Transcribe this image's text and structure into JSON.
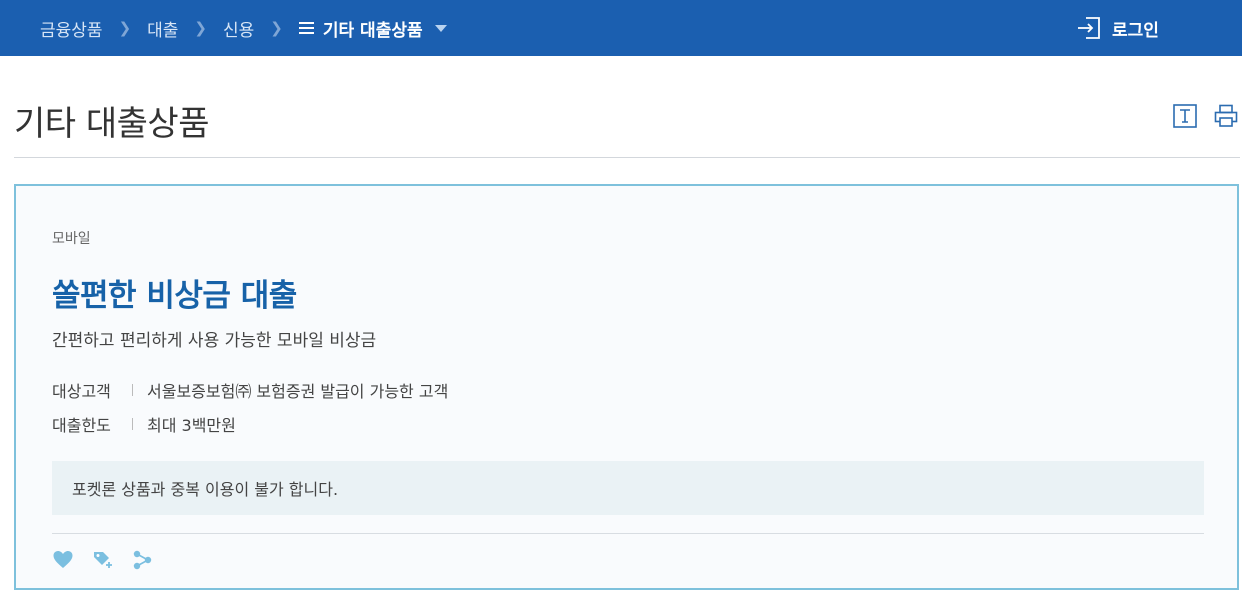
{
  "breadcrumb": {
    "items": [
      "금융상품",
      "대출",
      "신용"
    ],
    "current": "기타 대출상품"
  },
  "header": {
    "login_label": "로그인"
  },
  "page": {
    "title": "기타 대출상품",
    "icons": [
      "font-size-icon",
      "print-icon"
    ]
  },
  "product": {
    "category": "모바일",
    "name": "쏠편한 비상금 대출",
    "description": "간편하고 편리하게 사용 가능한 모바일 비상금",
    "info": [
      {
        "label": "대상고객",
        "value": "서울보증보험㈜ 보험증권 발급이 가능한 고객"
      },
      {
        "label": "대출한도",
        "value": "최대 3백만원"
      }
    ],
    "notice": "포켓론 상품과 중복 이용이 불가 합니다.",
    "action_icons": [
      "heart-icon",
      "tag-add-icon",
      "share-icon"
    ]
  },
  "colors": {
    "topbar": "#1b5fb0",
    "accent": "#1762a8",
    "card_border": "#7ec1dc",
    "notice_bg": "#eaf2f5",
    "action_icon": "#7bbfe0"
  }
}
